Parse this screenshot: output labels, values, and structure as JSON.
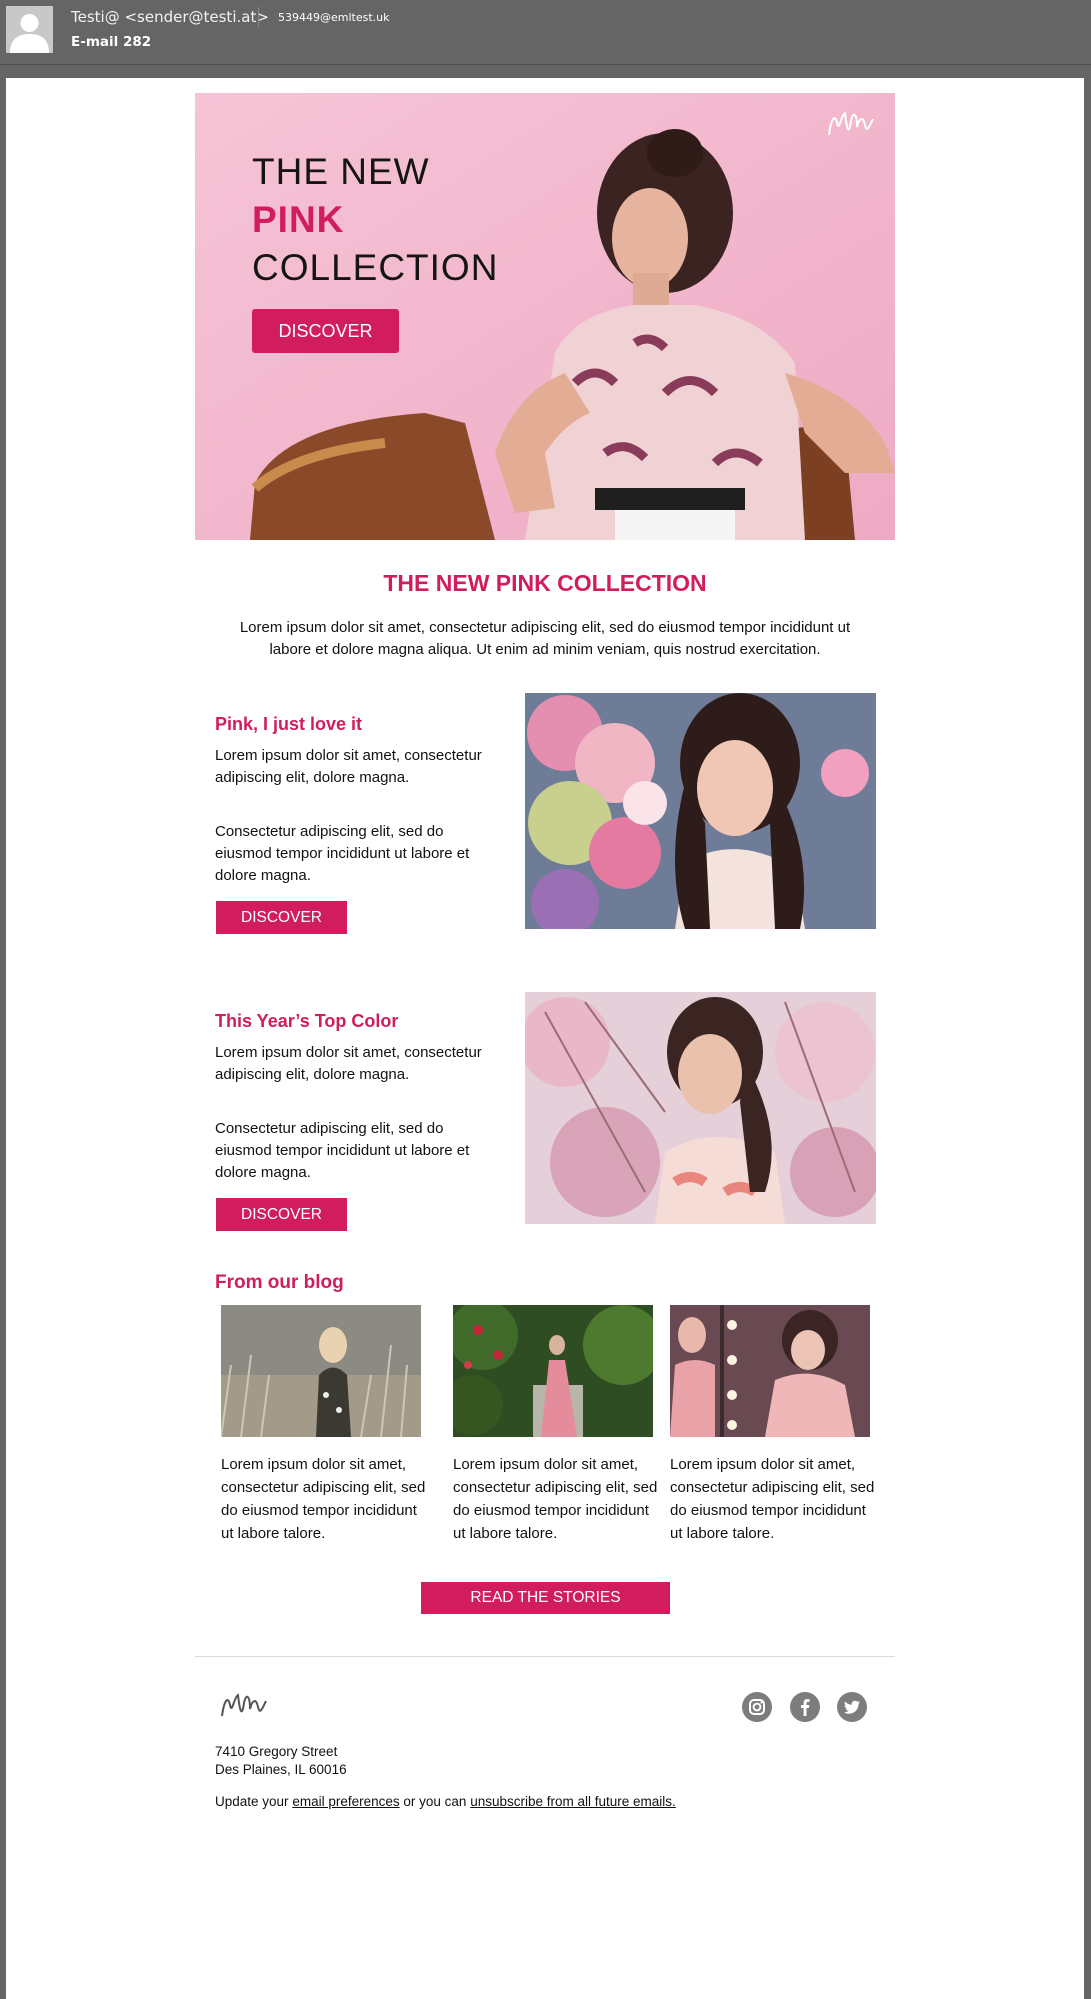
{
  "header": {
    "sender": "Testi@ <sender@testi.at>",
    "recipient": "539449@emltest.uk",
    "subject": "E-mail 282"
  },
  "hero": {
    "line1": "THE NEW",
    "line2": "PINK",
    "line3": "COLLECTION",
    "button": "DISCOVER"
  },
  "intro": {
    "title": "THE NEW PINK COLLECTION",
    "text": "Lorem ipsum dolor sit amet, consectetur adipiscing elit, sed do eiusmod tempor incididunt ut labore et dolore magna aliqua. Ut enim ad minim veniam, quis nostrud exercitation."
  },
  "features": [
    {
      "title": "Pink, I just love it",
      "p1": "Lorem ipsum dolor sit amet, consectetur adipiscing elit, dolore magna.",
      "p2": "Consectetur adipiscing elit, sed do eiusmod tempor incididunt ut labore et dolore magna.",
      "button": "DISCOVER"
    },
    {
      "title": "This Year’s Top Color",
      "p1": "Lorem ipsum dolor sit amet, consectetur adipiscing elit, dolore magna.",
      "p2": "Consectetur adipiscing elit, sed do eiusmod tempor incididunt ut labore et dolore magna.",
      "button": "DISCOVER"
    }
  ],
  "blog": {
    "title": "From our blog",
    "posts": [
      {
        "text": "Lorem ipsum dolor sit amet, consectetur adipiscing elit, sed do eiusmod tempor incididunt ut labore talore."
      },
      {
        "text": "Lorem ipsum dolor sit amet, consectetur adipiscing elit, sed do eiusmod tempor incididunt ut labore talore."
      },
      {
        "text": "Lorem ipsum dolor sit amet, consectetur adipiscing elit, sed do eiusmod tempor incididunt ut labore talore."
      }
    ],
    "button": "READ THE STORIES"
  },
  "footer": {
    "address1": "7410 Gregory Street",
    "address2": "Des Plaines, IL 60016",
    "text_before": "Update your",
    "link1": "email preferences",
    "text_middle": "or you can",
    "link2": "unsubscribe from all future emails.",
    "social": [
      "instagram-icon",
      "facebook-icon",
      "twitter-icon"
    ]
  },
  "colors": {
    "accent": "#d11c5e",
    "hero_bg": "#f4bcd1",
    "chrome": "#656565"
  }
}
